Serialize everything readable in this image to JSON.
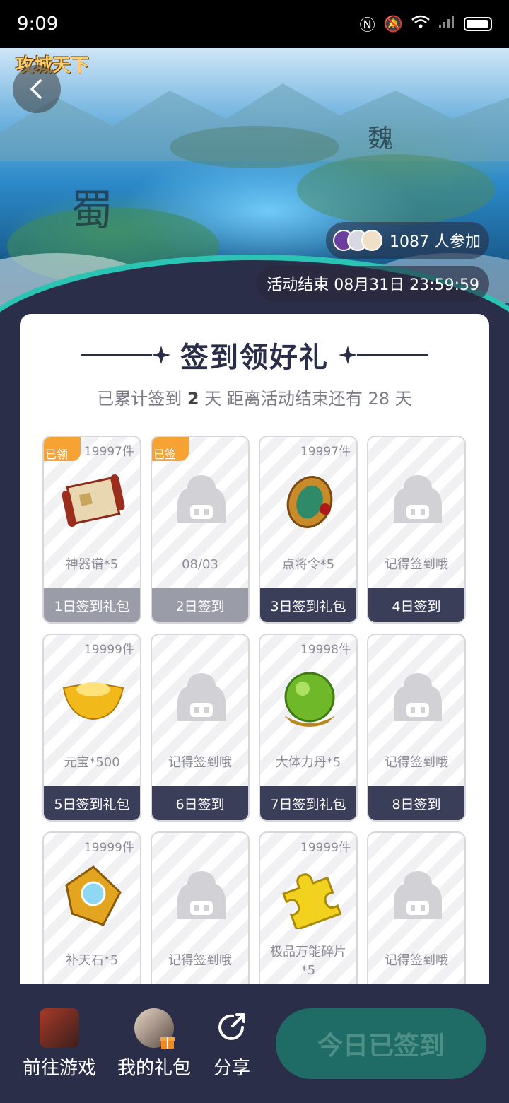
{
  "status_bar": {
    "time": "9:09"
  },
  "hero": {
    "logo_text": "攻城天下",
    "participants": "1087 人参加",
    "end_time": "活动结束 08月31日 23:59:59"
  },
  "card": {
    "title": "签到领好礼",
    "summary_prefix": "已累计签到",
    "summary_days": "2",
    "summary_mid": "天  距离活动结束还有",
    "summary_remaining": "28",
    "summary_suffix": "天"
  },
  "tiles": [
    {
      "stock": "19997件",
      "tag": "已领",
      "name": "神器谱*5",
      "footer": "1日签到礼包",
      "icon": "scroll-icon"
    },
    {
      "stock": "",
      "tag": "已签",
      "name": "08/03",
      "footer": "2日签到",
      "icon": "placeholder-icon"
    },
    {
      "stock": "19997件",
      "tag": "",
      "name": "点将令*5",
      "footer": "3日签到礼包",
      "icon": "token-icon"
    },
    {
      "stock": "",
      "tag": "",
      "name": "记得签到哦",
      "footer": "4日签到",
      "icon": "placeholder-icon"
    },
    {
      "stock": "19999件",
      "tag": "",
      "name": "元宝*500",
      "footer": "5日签到礼包",
      "icon": "gold-ingot-icon"
    },
    {
      "stock": "",
      "tag": "",
      "name": "记得签到哦",
      "footer": "6日签到",
      "icon": "placeholder-icon"
    },
    {
      "stock": "19998件",
      "tag": "",
      "name": "大体力丹*5",
      "footer": "7日签到礼包",
      "icon": "orb-icon"
    },
    {
      "stock": "",
      "tag": "",
      "name": "记得签到哦",
      "footer": "8日签到",
      "icon": "placeholder-icon"
    },
    {
      "stock": "19999件",
      "tag": "",
      "name": "补天石*5",
      "footer": "",
      "icon": "gem-icon"
    },
    {
      "stock": "",
      "tag": "",
      "name": "记得签到哦",
      "footer": "",
      "icon": "placeholder-icon"
    },
    {
      "stock": "19999件",
      "tag": "",
      "name": "极品万能碎片*5",
      "footer": "",
      "icon": "puzzle-icon"
    },
    {
      "stock": "",
      "tag": "",
      "name": "记得签到哦",
      "footer": "",
      "icon": "placeholder-icon"
    }
  ],
  "bottom_bar": {
    "game_label": "前往游戏",
    "gift_label": "我的礼包",
    "share_label": "分享",
    "signed_label": "今日已签到"
  },
  "colors": {
    "primary_dark": "#2b2e48",
    "tag_orange": "#f6a334",
    "signed_button": "#1f6b66"
  }
}
